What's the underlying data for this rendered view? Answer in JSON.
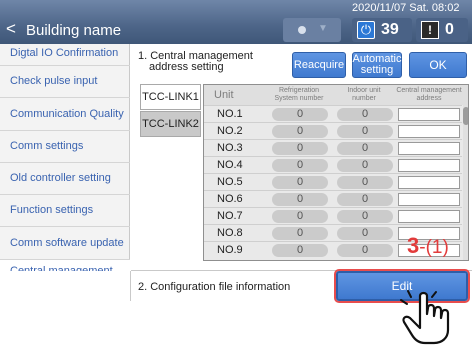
{
  "header": {
    "back_glyph": "<",
    "building_name": "Building name",
    "datetime": "2020/11/07 Sat. 08:02",
    "power_count": "39",
    "alarm_count": "0",
    "icons": [
      "back-chevron-icon",
      "toggle-dot-icon",
      "power-icon",
      "warning-icon"
    ]
  },
  "sidebar": {
    "items": [
      {
        "label": "Digtal IO Confirmation"
      },
      {
        "label": "Check pulse input"
      },
      {
        "label": "Communication Quality"
      },
      {
        "label": "Comm settings"
      },
      {
        "label": "Old controller setting"
      },
      {
        "label": "Function settings"
      },
      {
        "label": "Comm software update"
      },
      {
        "label": "Central management address Setting"
      }
    ]
  },
  "section1": {
    "title_line1": "1. Central management",
    "title_line2": "address setting",
    "reacquire_label": "Reacquire",
    "automatic_line1": "Automatic",
    "automatic_line2": "setting",
    "ok_label": "OK",
    "tabs": [
      "TCC-LINK1",
      "TCC-LINK2"
    ]
  },
  "table": {
    "headers": {
      "unit": "Unit",
      "refrig_line1": "Refrigeration",
      "refrig_line2": "System number",
      "indoor_line1": "Indoor unit",
      "indoor_line2": "number",
      "central_line1": "Central management",
      "central_line2": "address"
    },
    "rows": [
      {
        "unit": "NO.1",
        "refrig": "0",
        "indoor": "0",
        "address": ""
      },
      {
        "unit": "NO.2",
        "refrig": "0",
        "indoor": "0",
        "address": ""
      },
      {
        "unit": "NO.3",
        "refrig": "0",
        "indoor": "0",
        "address": ""
      },
      {
        "unit": "NO.4",
        "refrig": "0",
        "indoor": "0",
        "address": ""
      },
      {
        "unit": "NO.5",
        "refrig": "0",
        "indoor": "0",
        "address": ""
      },
      {
        "unit": "NO.6",
        "refrig": "0",
        "indoor": "0",
        "address": ""
      },
      {
        "unit": "NO.7",
        "refrig": "0",
        "indoor": "0",
        "address": ""
      },
      {
        "unit": "NO.8",
        "refrig": "0",
        "indoor": "0",
        "address": ""
      },
      {
        "unit": "NO.9",
        "refrig": "0",
        "indoor": "0",
        "address": ""
      }
    ]
  },
  "section2": {
    "title": "2. Configuration file information",
    "edit_label": "Edit"
  },
  "annotation": {
    "step_main": "3",
    "step_sub": "-(1)"
  },
  "colors": {
    "accent_blue": "#3f79cf",
    "header_blue": "#4d6588",
    "annotation_red": "#e23b3b"
  }
}
